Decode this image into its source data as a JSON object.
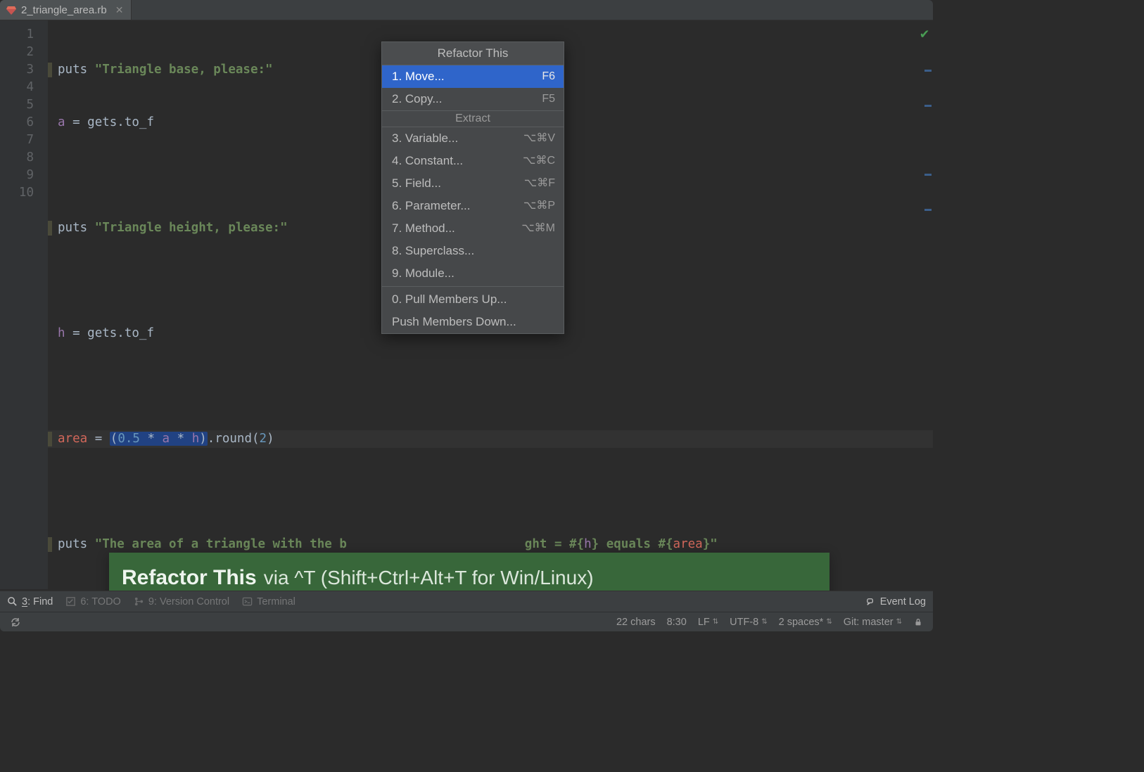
{
  "tab": {
    "filename": "2_triangle_area.rb"
  },
  "gutter": {
    "lines": [
      "1",
      "2",
      "3",
      "4",
      "5",
      "6",
      "7",
      "8",
      "9",
      "10"
    ]
  },
  "code": {
    "l1": {
      "kw": "puts ",
      "str": "\"Triangle base, please:\""
    },
    "l2": {
      "var": "a",
      "op": " = ",
      "call": "gets.to_f"
    },
    "l4": {
      "kw": "puts ",
      "str": "\"Triangle height, please:\""
    },
    "l6": {
      "var": "h",
      "op": " = ",
      "call": "gets.to_f"
    },
    "l8": {
      "area": "area",
      "op1": " = ",
      "p1": "(",
      "n1": "0.5",
      "s1": " * ",
      "v1": "a",
      "s2": " * ",
      "v2": "h",
      "p2": ")",
      "call": ".round(",
      "n2": "2",
      "p3": ")"
    },
    "l10": {
      "kw": "puts ",
      "s1": "\"The area of a triangle with the b",
      "s2": "ght = #{",
      "v1": "h",
      "s3": "} equals #{",
      "v2": "area",
      "s4": "}\""
    }
  },
  "popup": {
    "title": "Refactor This",
    "items_top": [
      {
        "label": "1. Move...",
        "shortcut": "F6",
        "selected": true
      },
      {
        "label": "2. Copy...",
        "shortcut": "F5",
        "selected": false
      }
    ],
    "section": "Extract",
    "items_mid": [
      {
        "label": "3. Variable...",
        "shortcut": "⌥⌘V"
      },
      {
        "label": "4. Constant...",
        "shortcut": "⌥⌘C"
      },
      {
        "label": "5. Field...",
        "shortcut": "⌥⌘F"
      },
      {
        "label": "6. Parameter...",
        "shortcut": "⌥⌘P"
      },
      {
        "label": "7. Method...",
        "shortcut": "⌥⌘M"
      },
      {
        "label": "8. Superclass...",
        "shortcut": ""
      },
      {
        "label": "9. Module...",
        "shortcut": ""
      }
    ],
    "items_bot": [
      {
        "label": "0. Pull Members Up..."
      },
      {
        "label": "Push Members Down..."
      }
    ]
  },
  "hint": {
    "strong": "Refactor This",
    "rest": " via ^T (Shift+Ctrl+Alt+T for Win/Linux)"
  },
  "toolstrip": {
    "find_prefix": "3",
    "find_suffix": ": Find",
    "todo": "6: TODO",
    "vcs": "9: Version Control",
    "terminal": "Terminal",
    "eventlog": "Event Log"
  },
  "status": {
    "chars": "22 chars",
    "pos": "8:30",
    "lf": "LF",
    "enc": "UTF-8",
    "indent": "2 spaces*",
    "git": "Git: master"
  }
}
